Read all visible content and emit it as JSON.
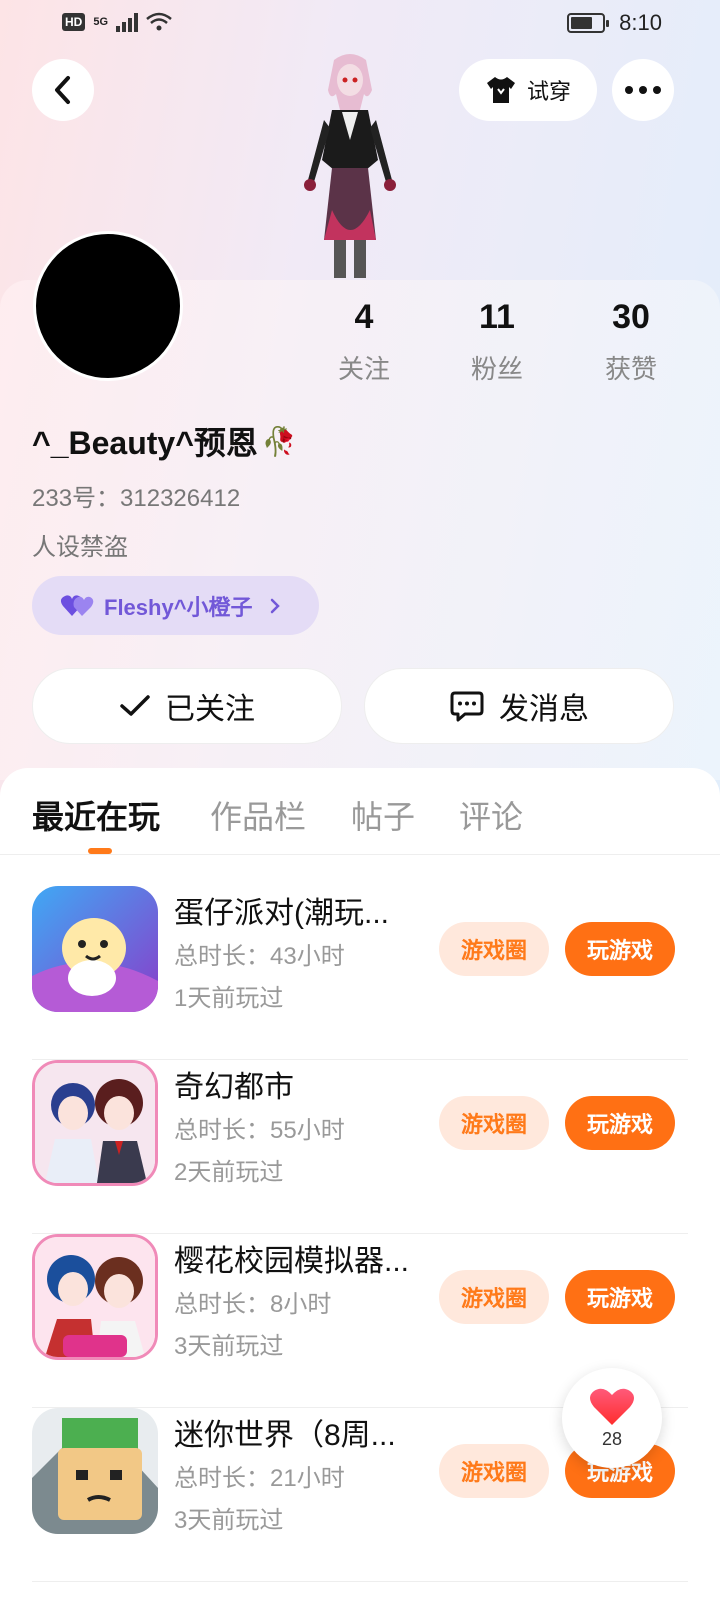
{
  "status_bar": {
    "network": "5G",
    "hd": "HD",
    "time": "8:10",
    "battery_level": 0.7
  },
  "header": {
    "try_on_label": "试穿"
  },
  "profile": {
    "username": "^_Beauty^预恩",
    "username_emoji": "🥀",
    "id_text": "233号：312326412",
    "bio": "人设禁盗",
    "cp_pill_label": "Fleshy^小橙子",
    "stats": [
      {
        "value": "4",
        "label": "关注"
      },
      {
        "value": "11",
        "label": "粉丝"
      },
      {
        "value": "30",
        "label": "获赞"
      }
    ]
  },
  "actions": {
    "follow_label": "已关注",
    "message_label": "发消息"
  },
  "tabs": [
    {
      "label": "最近在玩",
      "active": true
    },
    {
      "label": "作品栏",
      "active": false
    },
    {
      "label": "帖子",
      "active": false
    },
    {
      "label": "评论",
      "active": false
    }
  ],
  "games": [
    {
      "title": "蛋仔派对(潮玩...",
      "time": "总时长：43小时",
      "ago": "1天前玩过",
      "circle_label": "游戏圈",
      "play_label": "玩游戏"
    },
    {
      "title": "奇幻都市",
      "time": "总时长：55小时",
      "ago": "2天前玩过",
      "circle_label": "游戏圈",
      "play_label": "玩游戏"
    },
    {
      "title": "樱花校园模拟器...",
      "time": "总时长：8小时",
      "ago": "3天前玩过",
      "circle_label": "游戏圈",
      "play_label": "玩游戏"
    },
    {
      "title": "迷你世界（8周...",
      "time": "总时长：21小时",
      "ago": "3天前玩过",
      "circle_label": "游戏圈",
      "play_label": "玩游戏"
    }
  ],
  "like_button": {
    "count": "28"
  },
  "colors": {
    "accent": "#ff7014",
    "accent_light": "#ffe8dc",
    "purple": "#7258d8"
  }
}
